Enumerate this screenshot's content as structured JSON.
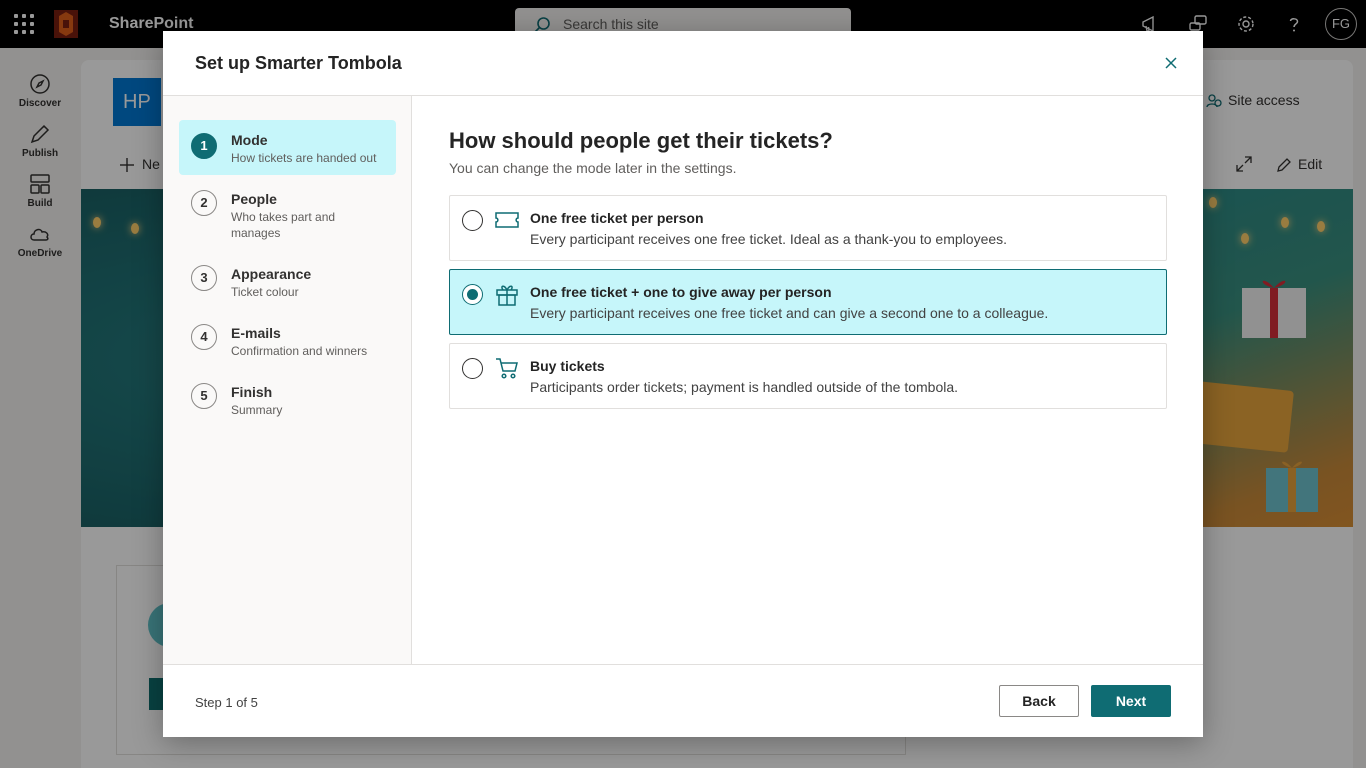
{
  "suite": {
    "app_name": "SharePoint",
    "search_placeholder": "Search this site",
    "avatar_initials": "FG"
  },
  "rail": {
    "items": [
      {
        "label": "Discover",
        "icon": "compass-icon"
      },
      {
        "label": "Publish",
        "icon": "pen-icon"
      },
      {
        "label": "Build",
        "icon": "layout-icon"
      },
      {
        "label": "OneDrive",
        "icon": "cloud-icon"
      }
    ]
  },
  "site": {
    "logo_initials": "HP",
    "site_access_label": "Site access",
    "new_label": "Ne",
    "edit_label": "Edit"
  },
  "dialog": {
    "title": "Set up Smarter Tombola",
    "close_icon": "close-icon",
    "steps": [
      {
        "number": "1",
        "title": "Mode",
        "subtitle": "How tickets are handed out",
        "active": true
      },
      {
        "number": "2",
        "title": "People",
        "subtitle": "Who takes part and manages",
        "active": false
      },
      {
        "number": "3",
        "title": "Appearance",
        "subtitle": "Ticket colour",
        "active": false
      },
      {
        "number": "4",
        "title": "E-mails",
        "subtitle": "Confirmation and winners",
        "active": false
      },
      {
        "number": "5",
        "title": "Finish",
        "subtitle": "Summary",
        "active": false
      }
    ],
    "question": "How should people get their tickets?",
    "question_sub": "You can change the mode later in the settings.",
    "options": [
      {
        "title": "One free ticket per person",
        "description": "Every participant receives one free ticket. Ideal as a thank-you to employees.",
        "icon": "ticket-icon",
        "selected": false
      },
      {
        "title": "One free ticket + one to give away per person",
        "description": "Every participant receives one free ticket and can give a second one to a colleague.",
        "icon": "gift-icon",
        "selected": true
      },
      {
        "title": "Buy tickets",
        "description": "Participants order tickets; payment is handled outside of the tombola.",
        "icon": "cart-icon",
        "selected": false
      }
    ],
    "step_counter": "Step 1 of 5",
    "back_label": "Back",
    "next_label": "Next"
  },
  "colors": {
    "accent": "#0f6c73",
    "selected_bg": "#c6f6fa",
    "suitebar": "#000000"
  }
}
